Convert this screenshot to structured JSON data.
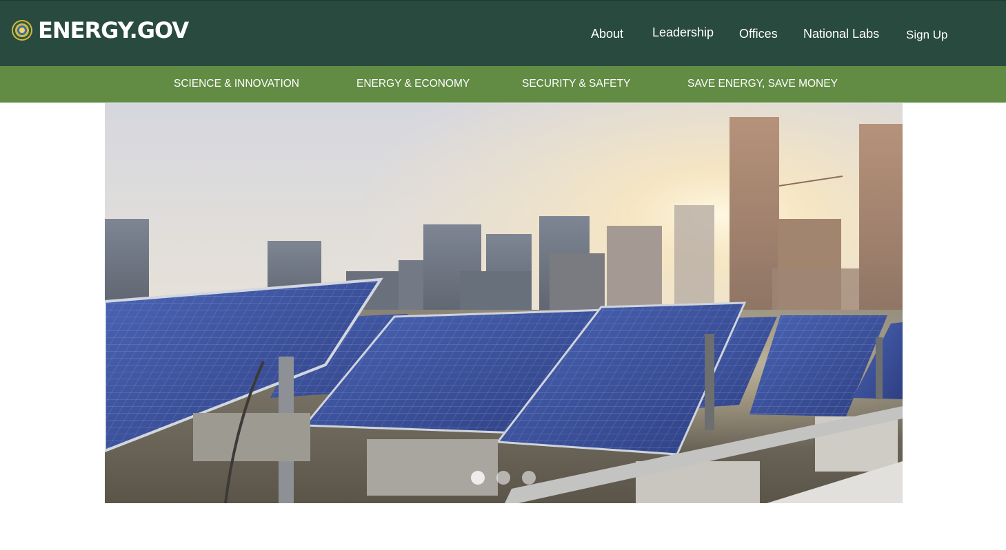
{
  "header": {
    "logo_text": "ENERGY.GOV",
    "logo_icon": "doe-seal-icon",
    "nav": [
      {
        "label": "About"
      },
      {
        "label": "Leadership"
      },
      {
        "label": "Offices"
      },
      {
        "label": "National Labs"
      },
      {
        "label": "Sign Up"
      }
    ]
  },
  "subnav": {
    "items": [
      {
        "label": "SCIENCE & INNOVATION"
      },
      {
        "label": "ENERGY & ECONOMY"
      },
      {
        "label": "SECURITY & SAFETY"
      },
      {
        "label": "SAVE ENERGY, SAVE MONEY"
      }
    ]
  },
  "hero": {
    "image": "solar-panels-city-skyline",
    "slides_count": 3,
    "active_slide": 1
  },
  "colors": {
    "header_bg": "#294a3f",
    "subnav_bg": "#628b44",
    "text": "#ffffff"
  }
}
